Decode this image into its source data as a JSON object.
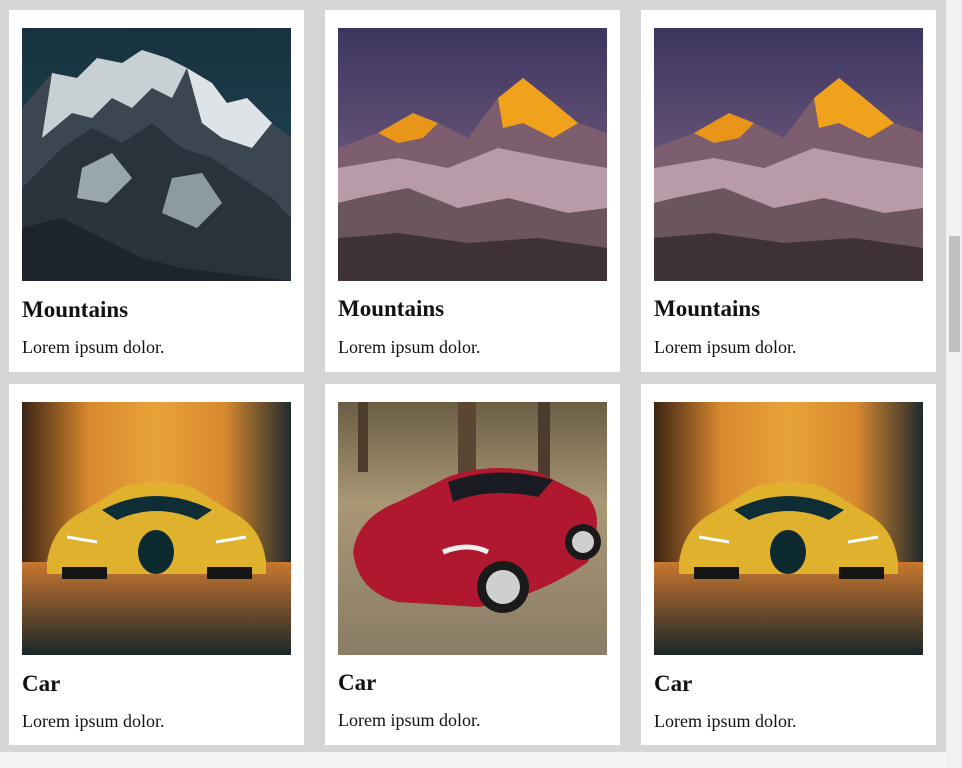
{
  "cards": [
    {
      "title": "Mountains",
      "text": "Lorem ipsum dolor.",
      "image": "snow-mountain-image"
    },
    {
      "title": "Mountains",
      "text": "Lorem ipsum dolor.",
      "image": "sunset-mountain-image"
    },
    {
      "title": "Mountains",
      "text": "Lorem ipsum dolor.",
      "image": "sunset-mountain-image"
    },
    {
      "title": "Car",
      "text": "Lorem ipsum dolor.",
      "image": "yellow-sports-car-image"
    },
    {
      "title": "Car",
      "text": "Lorem ipsum dolor.",
      "image": "red-sports-car-image"
    },
    {
      "title": "Car",
      "text": "Lorem ipsum dolor.",
      "image": "yellow-sports-car-image"
    }
  ],
  "colors": {
    "page_background": "#d6d6d6",
    "card_background": "#ffffff",
    "text": "#111111"
  }
}
